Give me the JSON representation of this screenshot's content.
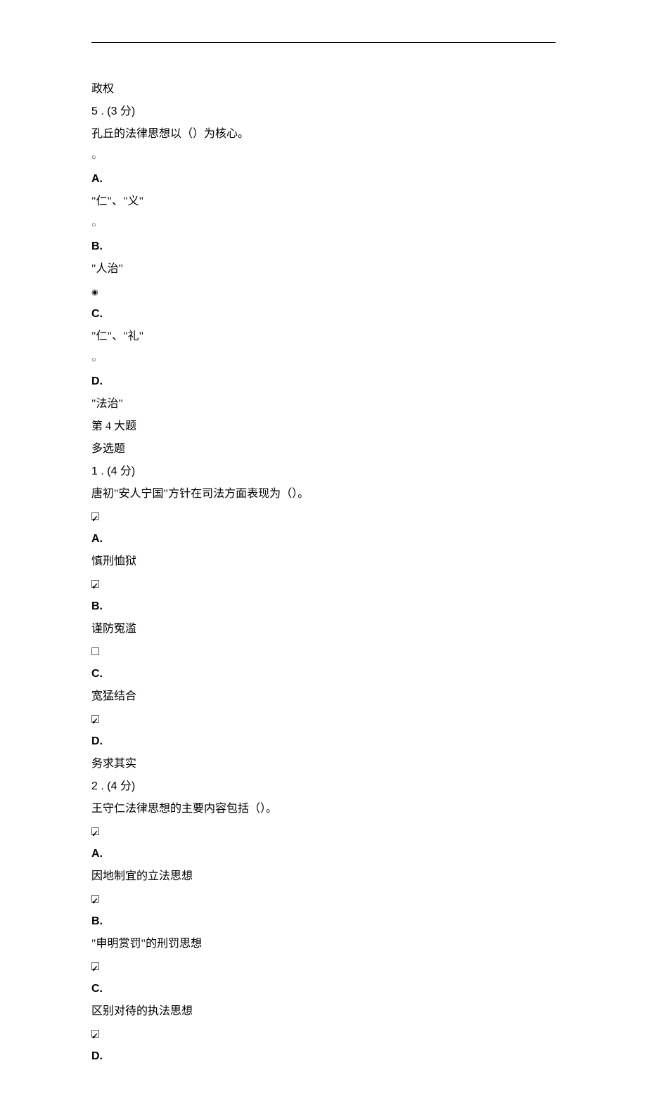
{
  "q4_carry": {
    "text": "政权"
  },
  "q5": {
    "header": "5 . (3 分)",
    "stem": "孔丘的法律思想以（）为核心。",
    "A": {
      "label": "A.",
      "text": "\"仁\"、\"义\"",
      "selected": false
    },
    "B": {
      "label": "B.",
      "text": "\"人治\"",
      "selected": false
    },
    "C": {
      "label": "C.",
      "text": "\"仁\"、\"礼\"",
      "selected": true
    },
    "D": {
      "label": "D.",
      "text": "\"法治\"",
      "selected": false
    }
  },
  "section4": {
    "title": "第 4 大题",
    "subtitle": "多选题"
  },
  "m1": {
    "header": "1 . (4 分)",
    "stem": "唐初\"安人宁国\"方针在司法方面表现为（）。",
    "A": {
      "label": "A.",
      "text": "慎刑恤狱",
      "checked": true
    },
    "B": {
      "label": "B.",
      "text": "谨防冤滥",
      "checked": true
    },
    "C": {
      "label": "C.",
      "text": "宽猛结合",
      "checked": false
    },
    "D": {
      "label": "D.",
      "text": "务求其实",
      "checked": true
    }
  },
  "m2": {
    "header": "2 . (4 分)",
    "stem": "王守仁法律思想的主要内容包括（）。",
    "A": {
      "label": "A.",
      "text": "因地制宜的立法思想",
      "checked": true
    },
    "B": {
      "label": "B.",
      "text": "\"申明赏罚\"的刑罚思想",
      "checked": true
    },
    "C": {
      "label": "C.",
      "text": "区别对待的执法思想",
      "checked": true
    },
    "D": {
      "label": "D.",
      "checked": true
    }
  }
}
